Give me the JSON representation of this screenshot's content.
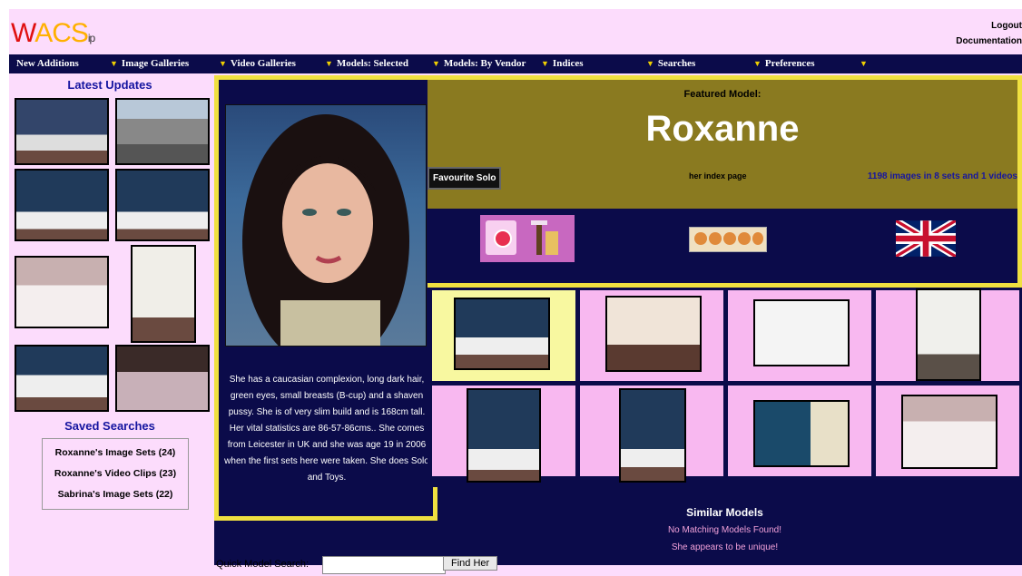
{
  "header": {
    "logo": {
      "w": "W",
      "acs": "ACS",
      "ip": "ip"
    },
    "links": [
      "Logout",
      "Documentation"
    ]
  },
  "menu": [
    {
      "label": "New Additions",
      "arrow": false
    },
    {
      "label": "Image Galleries",
      "arrow": true
    },
    {
      "label": "Video Galleries",
      "arrow": true
    },
    {
      "label": "Models: Selected",
      "arrow": true
    },
    {
      "label": "Models: By Vendor",
      "arrow": true
    },
    {
      "label": "Indices",
      "arrow": true
    },
    {
      "label": "Searches",
      "arrow": true
    },
    {
      "label": "Preferences",
      "arrow": true
    }
  ],
  "latest_updates": {
    "title": "Latest Updates"
  },
  "saved_searches": {
    "title": "Saved Searches",
    "items": [
      "Roxanne's Image Sets (24)",
      "Roxanne's Video Clips (23)",
      "Sabrina's Image Sets (22)"
    ]
  },
  "featured": {
    "label": "Featured Model:",
    "name": "Roxanne",
    "favourite_button": "Favourite Solo",
    "index_link": "her index page",
    "image_count": "1198 images in 8 sets and 1 videos",
    "description": "She has a caucasian complexion, long dark hair, green eyes, small breasts (B-cup) and a shaven pussy. She is of very slim build and is 168cm tall. Her vital statistics are 86-57-86cms.. She comes from Leicester in UK and she was age 19 in 2006 when the first sets here were taken. She does Solo and Toys."
  },
  "similar": {
    "title": "Similar Models",
    "line1": "No Matching Models Found!",
    "line2": "She appears to be unique!"
  },
  "search": {
    "label": "Quick Model Search:",
    "button": "Find Her",
    "value": ""
  }
}
